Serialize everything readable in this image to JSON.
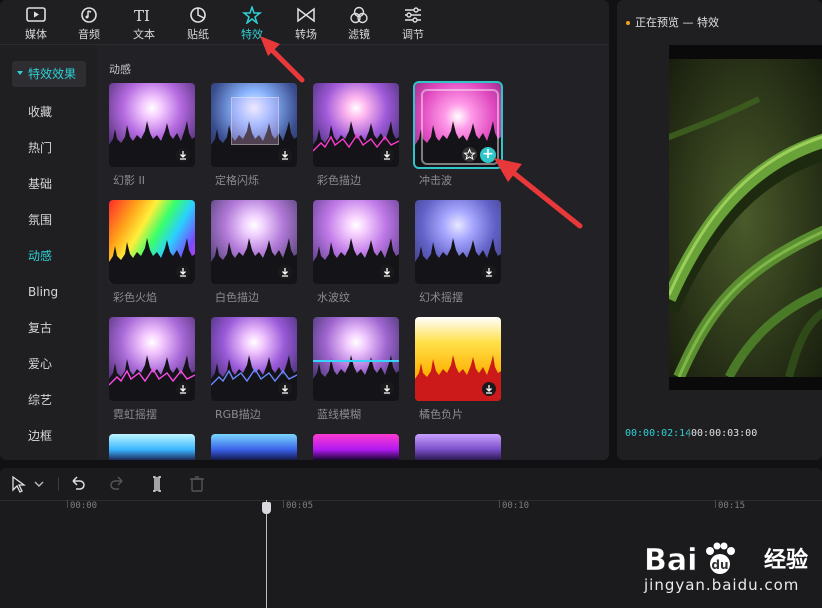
{
  "toolbar": {
    "items": [
      {
        "label": "媒体",
        "icon": "media-icon"
      },
      {
        "label": "音频",
        "icon": "audio-icon"
      },
      {
        "label": "文本",
        "icon": "text-icon"
      },
      {
        "label": "贴纸",
        "icon": "sticker-icon"
      },
      {
        "label": "特效",
        "icon": "effects-icon"
      },
      {
        "label": "转场",
        "icon": "transition-icon"
      },
      {
        "label": "滤镜",
        "icon": "filter-icon"
      },
      {
        "label": "调节",
        "icon": "adjust-icon"
      }
    ],
    "active": "特效"
  },
  "sidebar": {
    "category": "特效效果",
    "items": [
      "收藏",
      "热门",
      "基础",
      "氛围",
      "动感",
      "Bling",
      "复古",
      "爱心",
      "综艺",
      "边框"
    ],
    "active": "动感"
  },
  "grid": {
    "section_title": "动感",
    "cards": [
      {
        "label": "幻影 II"
      },
      {
        "label": "定格闪烁"
      },
      {
        "label": "彩色描边"
      },
      {
        "label": "冲击波"
      },
      {
        "label": "彩色火焰"
      },
      {
        "label": "白色描边"
      },
      {
        "label": "水波纹"
      },
      {
        "label": "幻术摇摆"
      },
      {
        "label": "霓虹摇摆"
      },
      {
        "label": "RGB描边"
      },
      {
        "label": "蓝线模糊"
      },
      {
        "label": "橘色负片"
      }
    ],
    "selected": "冲击波"
  },
  "preview": {
    "title": "正在预览 — 特效",
    "current_time": "00:00:02:14",
    "total_time": "00:00:03:00"
  },
  "timeline": {
    "ruler": [
      "00:00",
      "00:05",
      "00:10",
      "00:15"
    ]
  },
  "watermark": {
    "brand": "Baidu经验",
    "url": "jingyan.baidu.com"
  },
  "colors": {
    "accent": "#2fd0d4",
    "panel": "#1f1f22",
    "arrow": "#e8383a"
  }
}
